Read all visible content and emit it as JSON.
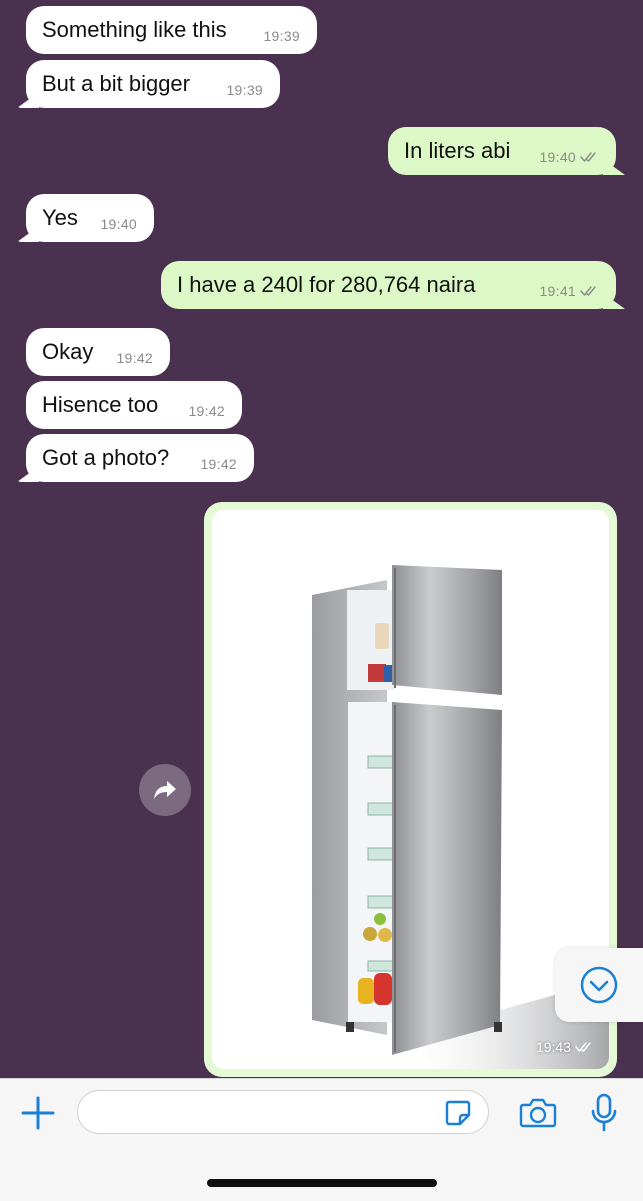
{
  "messages": [
    {
      "text": "Something like this",
      "time": "19:39"
    },
    {
      "text": "But a bit bigger",
      "time": "19:39"
    },
    {
      "text": "In liters abi",
      "time": "19:40"
    },
    {
      "text": "Yes",
      "time": "19:40"
    },
    {
      "text": "I have a 240l for 280,764 naira",
      "time": "19:41"
    },
    {
      "text": "Okay",
      "time": "19:42"
    },
    {
      "text": "Hisence too",
      "time": "19:42"
    },
    {
      "text": "Got a photo?",
      "time": "19:42"
    }
  ],
  "image_message": {
    "time": "19:43"
  },
  "icons": {
    "forward": "forward-icon",
    "scroll_down": "chevron-down-icon",
    "attach": "plus-icon",
    "sticker": "sticker-icon",
    "camera": "camera-icon",
    "microphone": "microphone-icon",
    "read_receipt": "double-check-icon"
  },
  "composer": {
    "placeholder": ""
  },
  "colors": {
    "background": "#4a3150",
    "incoming_bubble": "#ffffff",
    "outgoing_bubble": "#dcf8c6",
    "accent": "#1a7fd6"
  }
}
